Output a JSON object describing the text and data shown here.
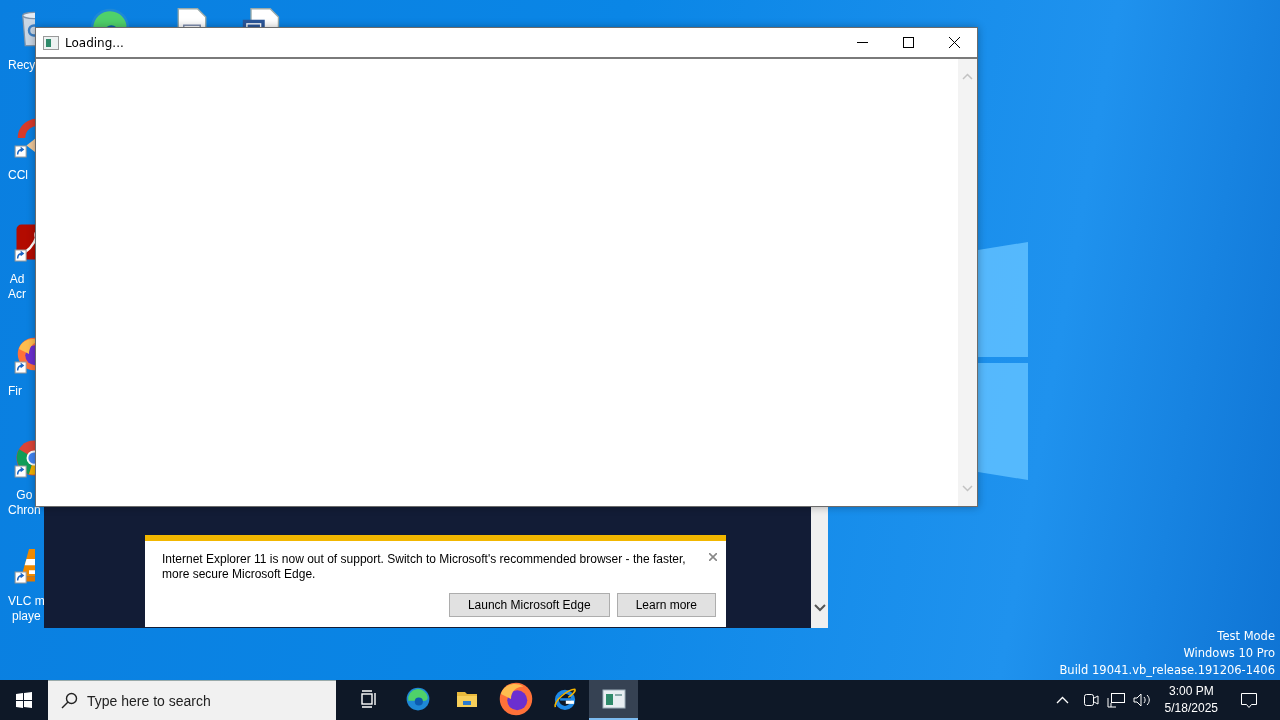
{
  "desktop_icons": [
    {
      "kind": "recycle",
      "label_lines": [
        "Recy"
      ],
      "shortcut": false
    },
    {
      "kind": "cleaner",
      "label_lines": [
        "CCl"
      ],
      "shortcut": true
    },
    {
      "kind": "reader",
      "label_lines": [
        "Ad",
        "Acr"
      ],
      "shortcut": true
    },
    {
      "kind": "firefox",
      "label_lines": [
        "Fir"
      ],
      "shortcut": true
    },
    {
      "kind": "chrome",
      "label_lines": [
        "Go",
        "Chron"
      ],
      "shortcut": true
    },
    {
      "kind": "vlc",
      "label_lines": [
        "VLC m",
        "playe"
      ],
      "shortcut": true
    }
  ],
  "top_icons": [
    {
      "kind": "edge"
    },
    {
      "kind": "document"
    },
    {
      "kind": "word"
    }
  ],
  "window": {
    "title": "Loading..."
  },
  "ie_notification": {
    "message": "Internet Explorer 11 is now out of support. Switch to Microsoft's recommended browser - the faster, more secure Microsoft Edge.",
    "buttons": [
      "Launch Microsoft Edge",
      "Learn more"
    ]
  },
  "desktop_info": [
    "Test Mode",
    "Windows 10 Pro",
    "Build 19041.vb_release.191206-1406"
  ],
  "taskbar": {
    "search": {
      "placeholder": "Type here to search"
    },
    "apps": [
      {
        "kind": "taskview",
        "active": false
      },
      {
        "kind": "edge",
        "active": false
      },
      {
        "kind": "folder",
        "active": false
      },
      {
        "kind": "firefox",
        "active": false
      },
      {
        "kind": "ie",
        "active": false
      },
      {
        "kind": "window",
        "active": true
      }
    ],
    "tray": {
      "time": "3:00 PM",
      "date": "5/18/2025"
    }
  }
}
